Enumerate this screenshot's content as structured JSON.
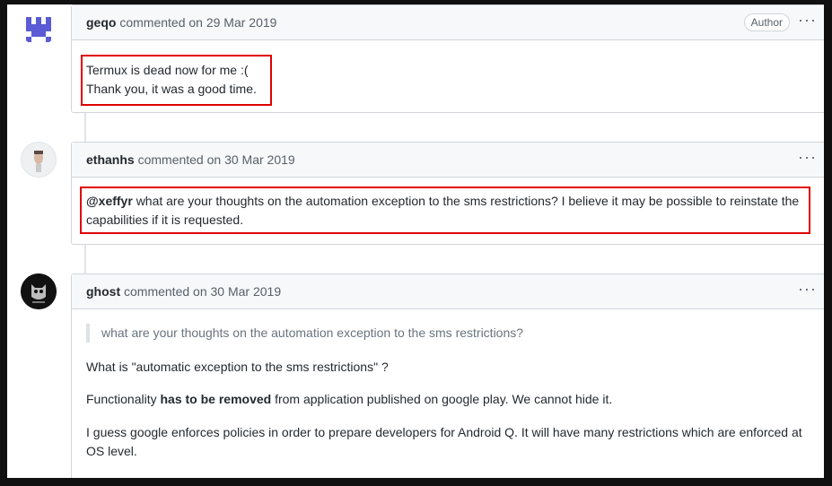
{
  "comments": [
    {
      "author": "geqo",
      "meta": "commented on 29 Mar 2019",
      "badge": "Author",
      "menu": "···",
      "lines": [
        "Termux is dead now for me :(",
        "Thank you, it was a good time."
      ]
    },
    {
      "author": "ethanhs",
      "meta": "commented on 30 Mar 2019",
      "menu": "···",
      "mention": "@xeffyr",
      "text": "what are your thoughts on the automation exception to the sms restrictions? I believe it may be possible to reinstate the capabilities if it is requested."
    },
    {
      "author": "ghost",
      "meta": "commented on 30 Mar 2019",
      "menu": "···",
      "quote": "what are your thoughts on the automation exception to the sms restrictions?",
      "p1": "What is \"automatic exception to the sms restrictions\" ?",
      "p2_before": "Functionality",
      "p2_bold": "has to be removed",
      "p2_after": "from application published on google play. We cannot hide it.",
      "p3": "I guess google enforces policies in order to prepare developers for Android Q. It will have many restrictions which are enforced at OS level."
    }
  ]
}
